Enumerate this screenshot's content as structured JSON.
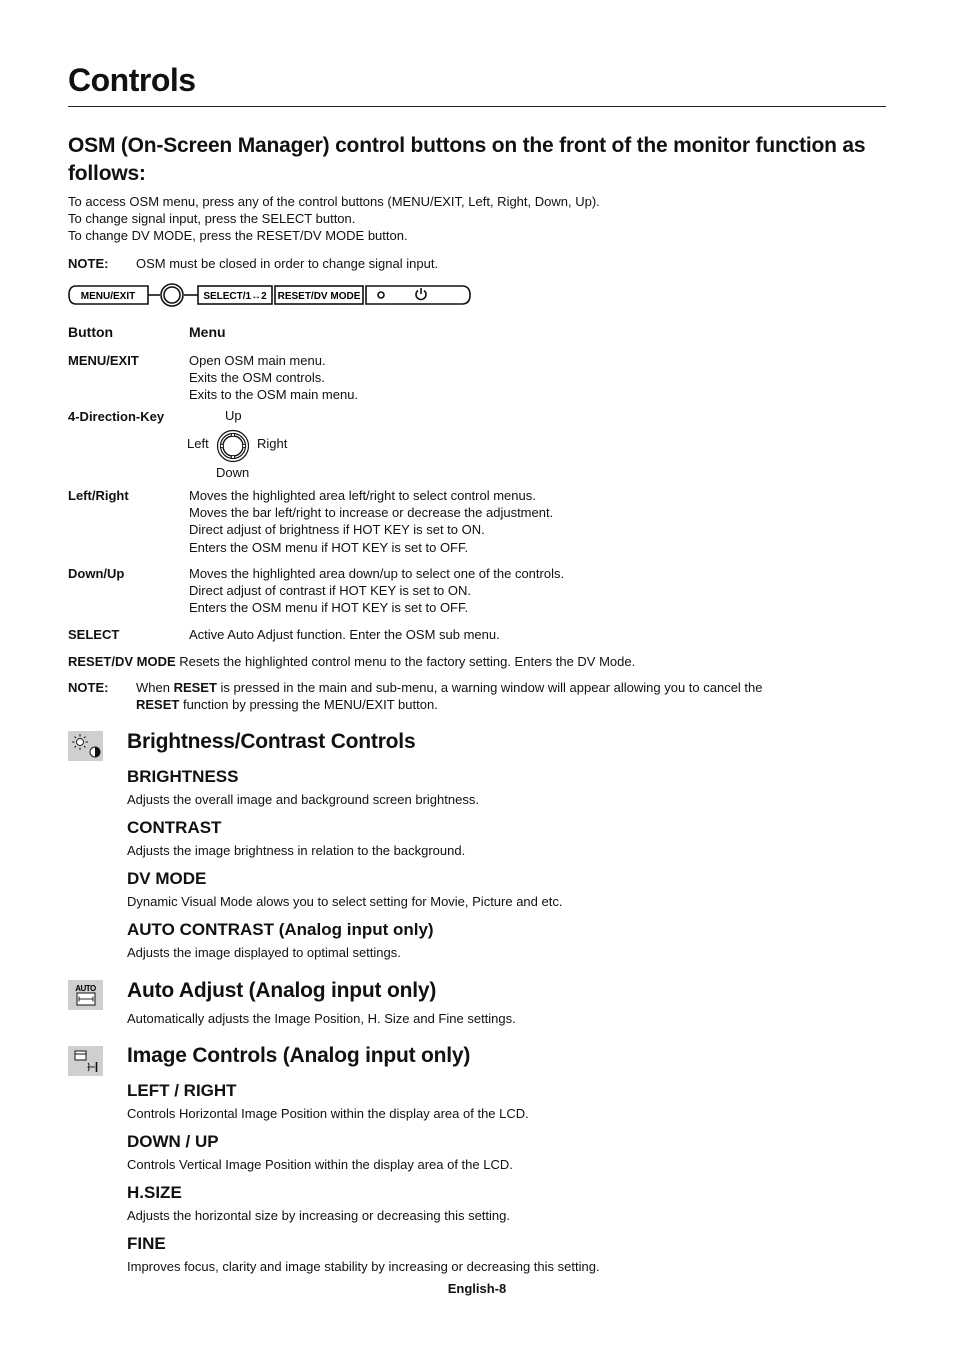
{
  "page": {
    "title": "Controls",
    "heading": "OSM (On-Screen Manager) control buttons on the front of the monitor function as follows:",
    "intro": [
      "To access OSM menu, press any of the control buttons (MENU/EXIT, Left, Right, Down, Up).",
      "To change signal input, press the SELECT button.",
      "To change DV MODE, press the RESET/DV MODE button."
    ],
    "note1": {
      "label": "NOTE:",
      "text": "OSM must be closed in order to change signal input."
    },
    "button_bar": {
      "menu_exit": "MENU/EXIT",
      "select": "SELECT/1↔2",
      "reset_dv": "RESET/DV MODE"
    },
    "table": {
      "header": {
        "button": "Button",
        "menu": "Menu"
      },
      "rows": [
        {
          "button": "MENU/EXIT",
          "lines": [
            "Open OSM main menu.",
            "Exits the OSM controls.",
            "Exits to the OSM main menu."
          ]
        },
        {
          "button": "4-Direction-Key",
          "directions": {
            "up": "Up",
            "left": "Left",
            "right": "Right",
            "down": "Down"
          }
        },
        {
          "button": "Left/Right",
          "lines": [
            "Moves the highlighted area left/right to select control menus.",
            "Moves the bar left/right to increase or decrease the adjustment.",
            "Direct adjust of brightness if HOT KEY is set to ON.",
            "Enters the OSM menu if HOT KEY is set to OFF."
          ]
        },
        {
          "button": "Down/Up",
          "lines": [
            "Moves the highlighted area down/up to select one of the controls.",
            "Direct adjust of contrast if HOT KEY is set to ON.",
            "Enters the OSM menu if HOT KEY is set to OFF."
          ]
        },
        {
          "button": "SELECT",
          "lines": [
            "Active Auto Adjust function. Enter the OSM sub menu."
          ]
        },
        {
          "button": "RESET/DV MODE",
          "lines": [
            "Resets the highlighted control menu to the factory setting. Enters the DV Mode."
          ]
        }
      ]
    },
    "note2": {
      "label": "NOTE:",
      "pre": "When ",
      "bold1": "RESET",
      "mid": " is pressed in the main and sub-menu, a warning window will appear allowing you to cancel the",
      "bold2": "RESET",
      "post": " function by pressing the MENU/EXIT button."
    },
    "sections": [
      {
        "title": "Brightness/Contrast Controls",
        "icon": "brightness-contrast-icon",
        "items": [
          {
            "title": "BRIGHTNESS",
            "desc": "Adjusts the overall image and background screen brightness."
          },
          {
            "title": "CONTRAST",
            "desc": "Adjusts the image brightness in relation to the background."
          },
          {
            "title": "DV MODE",
            "desc": "Dynamic Visual Mode alows you to select setting for Movie, Picture and etc."
          },
          {
            "title": "AUTO CONTRAST (Analog input only)",
            "desc": "Adjusts the image displayed to optimal settings."
          }
        ]
      },
      {
        "title": "Auto Adjust (Analog input only)",
        "icon": "auto-adjust-icon",
        "icon_label": "AUTO",
        "desc": "Automatically adjusts the Image Position, H. Size and Fine settings."
      },
      {
        "title": "Image Controls (Analog input only)",
        "icon": "image-controls-icon",
        "items": [
          {
            "title": "LEFT / RIGHT",
            "desc": "Controls Horizontal Image Position within the display area of the LCD."
          },
          {
            "title": "DOWN / UP",
            "desc": "Controls Vertical Image Position within the display area of the LCD."
          },
          {
            "title": "H.SIZE",
            "desc": "Adjusts the horizontal size by increasing or decreasing this setting."
          },
          {
            "title": "FINE",
            "desc": "Improves focus, clarity and image stability by increasing or decreasing this setting."
          }
        ]
      }
    ],
    "footer": "English-8"
  }
}
